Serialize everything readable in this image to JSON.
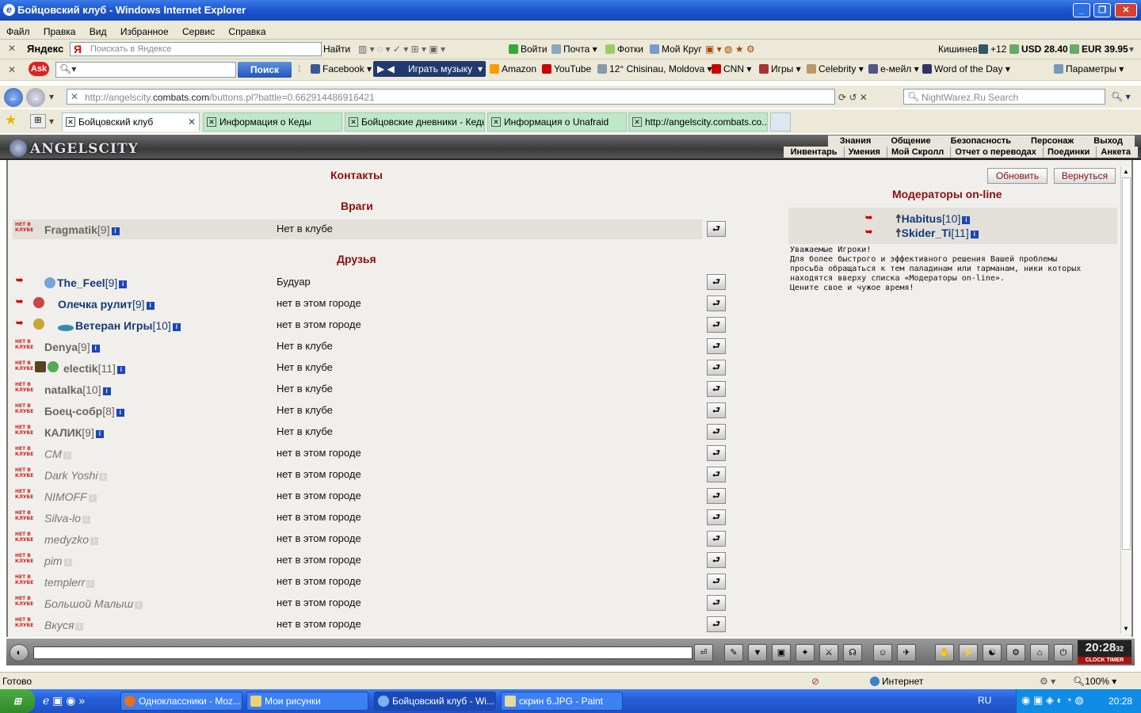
{
  "window": {
    "title": "Бойцовский клуб - Windows Internet Explorer"
  },
  "menu": [
    "Файл",
    "Правка",
    "Вид",
    "Избранное",
    "Сервис",
    "Справка"
  ],
  "yandex_bar": {
    "brand": "Яндекс",
    "search_placeholder": "Поискать в Яндексе",
    "find_label": "Найти",
    "items": [
      "Войти",
      "Почта",
      "Фотки",
      "Мой Круг"
    ],
    "city": "Кишинев",
    "temp": "+12",
    "usd": "USD 28.40",
    "eur": "EUR 39.95"
  },
  "ask_bar": {
    "brand": "Ask",
    "search_button": "Поиск",
    "items": [
      "Facebook",
      "Играть музыку",
      "Amazon",
      "YouTube",
      "12° Chisinau, Moldova",
      "CNN",
      "Игры",
      "Celebrity",
      "e-мейл",
      "Word of the Day"
    ],
    "settings": "Параметры"
  },
  "address": {
    "url_prefix": "http://angelscity.",
    "url_host": "combats.com",
    "url_rest": "/buttons.pl?battle=0.662914486916421",
    "search_placeholder": "NightWarez.Ru Search"
  },
  "tabs": [
    "Бойцовский клуб",
    "Информация о Кеды",
    "Бойцовские дневники - Кеды",
    "Информация о Unafraid",
    "http://angelscity.combats.co..."
  ],
  "game": {
    "logo": "ANGELSCITY",
    "nav_top": [
      "Знания",
      "Общение",
      "Безопасность",
      "Персонаж",
      "Выход"
    ],
    "nav_bottom": [
      "Инвентарь",
      "Умения",
      "Мой Скролл",
      "Отчет о переводах",
      "Поединки",
      "Анкета"
    ]
  },
  "contacts": {
    "title": "Контакты",
    "enemies_header": "Враги",
    "friends_header": "Друзья",
    "offline_badge": "НЕТ В КЛУБЕ",
    "enemies": [
      {
        "name": "Fragmatik",
        "level": "[9]",
        "location": "Нет в клубе"
      }
    ],
    "friends": [
      {
        "name": "The_Feel",
        "level": "[9]",
        "location": "Будуар"
      },
      {
        "name": "Олечка рулит",
        "level": "[9]",
        "location": "нет в этом городе"
      },
      {
        "name": "Ветеран Игры",
        "level": "[10]",
        "location": "нет в этом городе"
      },
      {
        "name": "Denya",
        "level": "[9]",
        "location": "Нет в клубе"
      },
      {
        "name": "electik",
        "level": "[11]",
        "location": "Нет в клубе"
      },
      {
        "name": "natalka",
        "level": "[10]",
        "location": "Нет в клубе"
      },
      {
        "name": "Боец-собр",
        "level": "[8]",
        "location": "Нет в клубе"
      },
      {
        "name": "КАЛИК",
        "level": "[9]",
        "location": "Нет в клубе"
      },
      {
        "name": "CM",
        "level": "",
        "location": "нет в этом городе"
      },
      {
        "name": "Dark Yoshi",
        "level": "",
        "location": "нет в этом городе"
      },
      {
        "name": "NIMOFF",
        "level": "",
        "location": "нет в этом городе"
      },
      {
        "name": "Silva-lo",
        "level": "",
        "location": "нет в этом городе"
      },
      {
        "name": "medyzko",
        "level": "",
        "location": "нет в этом городе"
      },
      {
        "name": "pim",
        "level": "",
        "location": "нет в этом городе"
      },
      {
        "name": "templerr",
        "level": "",
        "location": "нет в этом городе"
      },
      {
        "name": "Большой Малыш",
        "level": "",
        "location": "нет в этом городе"
      },
      {
        "name": "Вкуся",
        "level": "",
        "location": "нет в этом городе"
      }
    ],
    "refresh_button": "Обновить",
    "back_button": "Вернуться"
  },
  "moderators": {
    "title": "Модераторы on-line",
    "list": [
      {
        "name": "Habitus",
        "level": "[10]"
      },
      {
        "name": "Skider_Ti",
        "level": "[11]"
      }
    ],
    "note": [
      "Уважаемые Игроки!",
      "Для более быстрого и эффективного решения Вашей проблемы",
      "просьба обращаться к тем паладинам или тарманам, ники которых",
      "находятся вверху списка «Модераторы on-line».",
      "Цените свое и чужое время!"
    ]
  },
  "clock": {
    "time": "20:28",
    "seconds": "32",
    "labels": "CLOCK TIMER"
  },
  "status": {
    "text": "Готово",
    "zone": "Интернет",
    "zoom": "100%"
  },
  "taskbar": {
    "start": "пуск",
    "tasks": [
      "Одноклассники - Moz...",
      "Мои рисунки",
      "Бойцовский клуб - Wi...",
      "скрин 6.JPG - Paint"
    ],
    "lang": "RU",
    "time": "20:28"
  }
}
